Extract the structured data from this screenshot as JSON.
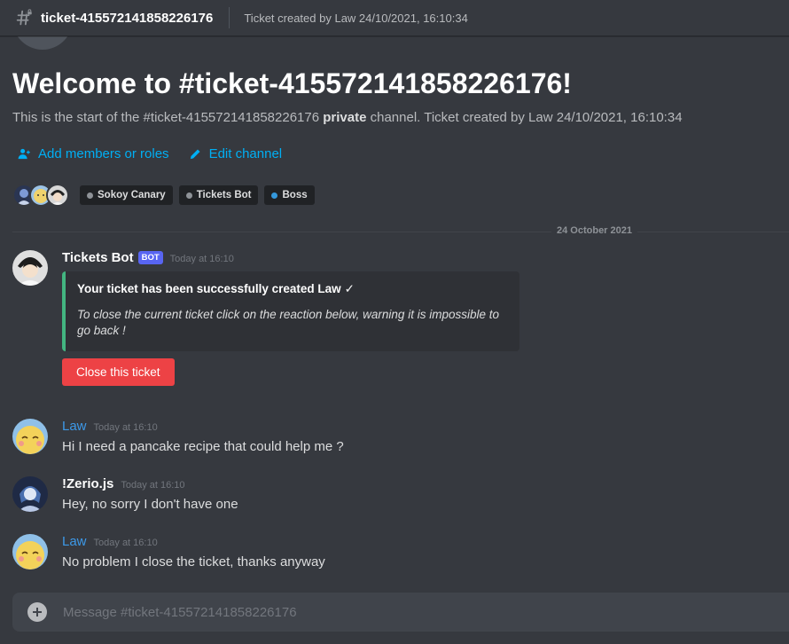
{
  "header": {
    "channel_name": "ticket-415572141858226176",
    "topic": "Ticket created by Law 24/10/2021, 16:10:34"
  },
  "welcome": {
    "title": "Welcome to #ticket-415572141858226176!",
    "desc_prefix": "This is the start of the #ticket-415572141858226176 ",
    "desc_bold": "private",
    "desc_suffix": " channel. Ticket created by Law 24/10/2021, 16:10:34"
  },
  "actions": {
    "add_members": "Add members or roles",
    "edit_channel": "Edit channel"
  },
  "members": [
    {
      "name": "Sokoy Canary",
      "color": "#8e9297"
    },
    {
      "name": "Tickets Bot",
      "color": "#8e9297"
    },
    {
      "name": "Boss",
      "color": "#3498db"
    }
  ],
  "date_divider": "24 October 2021",
  "messages": [
    {
      "author": "Tickets Bot",
      "tag": "BOT",
      "time": "Today at 16:10",
      "embed": {
        "title": "Your ticket has been successfully created Law",
        "check": "✓",
        "description": "To close the current ticket click on the reaction below, warning it is impossible to go back !",
        "color": "#43b581"
      },
      "button": "Close this ticket"
    },
    {
      "author": "Law",
      "time": "Today at 16:10",
      "text": "Hi I need a pancake recipe that could help me ?"
    },
    {
      "author": "!Zerio.js",
      "time": "Today at 16:10",
      "text": "Hey, no sorry I don't have one"
    },
    {
      "author": "Law",
      "time": "Today at 16:10",
      "text": "No problem I close the ticket, thanks anyway"
    }
  ],
  "composer": {
    "placeholder": "Message #ticket-415572141858226176"
  },
  "colors": {
    "accent": "#00aff4",
    "danger": "#ed4245",
    "law_name": "#3d99e8"
  }
}
